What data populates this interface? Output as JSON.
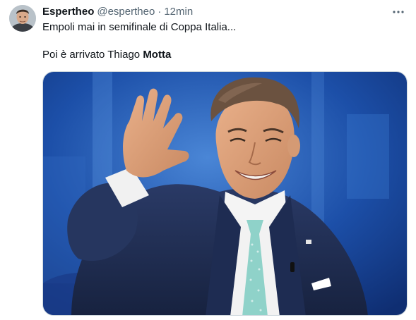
{
  "tweet": {
    "display_name": "Espertheo",
    "handle": "@espertheo",
    "separator": "·",
    "time": "12min",
    "text_line1": "Empoli mai in semifinale di Coppa Italia...",
    "text_line2_prefix": "Poi è arrivato Thiago ",
    "text_line2_bold": "Motta",
    "more_icon": "more-horizontal-icon",
    "media_kind": "photo"
  },
  "colors": {
    "text_primary": "#0f1419",
    "text_secondary": "#536471",
    "media_border": "#cfd9de",
    "studio_blue": "#1c4fa8"
  }
}
